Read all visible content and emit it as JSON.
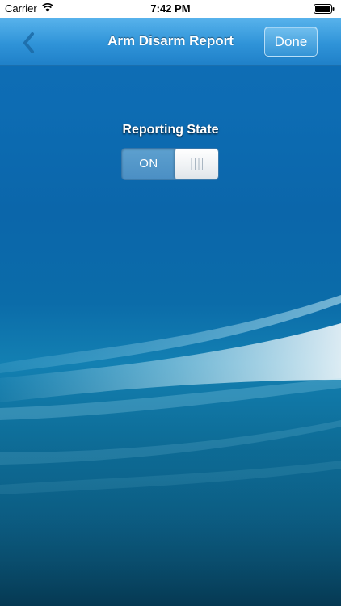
{
  "status_bar": {
    "carrier": "Carrier",
    "time": "7:42 PM",
    "icons": [
      "wifi-icon",
      "battery-icon"
    ]
  },
  "nav": {
    "back_icon": "chevron-left-icon",
    "title": "Arm Disarm Report",
    "done_label": "Done"
  },
  "content": {
    "section_label": "Reporting State",
    "toggle": {
      "label": "ON",
      "state": "on"
    }
  },
  "colors": {
    "nav_gradient_top": "#58b3ec",
    "nav_gradient_bottom": "#1f80c8",
    "background_top": "#0f6fb8",
    "background_bottom": "#07435f",
    "toggle_track": "#5da0cf"
  }
}
